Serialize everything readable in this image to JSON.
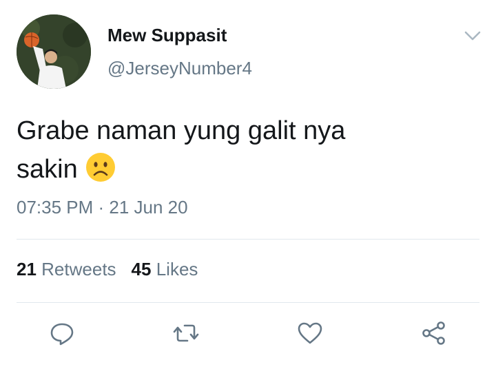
{
  "tweet": {
    "author": {
      "display_name": "Mew Suppasit",
      "handle": "@JerseyNumber4",
      "avatar_icon": "profile-photo-basketball"
    },
    "text_line1": "Grabe naman yung galit nya",
    "text_line2": "sakin",
    "emoji": "frowning-face-emoji",
    "timestamp": "07:35 PM · 21 Jun 20",
    "stats": {
      "retweets_count": "21",
      "retweets_label": "Retweets",
      "likes_count": "45",
      "likes_label": "Likes"
    },
    "actions": [
      "reply-icon",
      "retweet-icon",
      "like-icon",
      "share-icon"
    ]
  },
  "colors": {
    "primary_text": "#14171a",
    "secondary_text": "#657786",
    "divider": "#e1e8ed",
    "emoji_yellow": "#ffcc33"
  }
}
